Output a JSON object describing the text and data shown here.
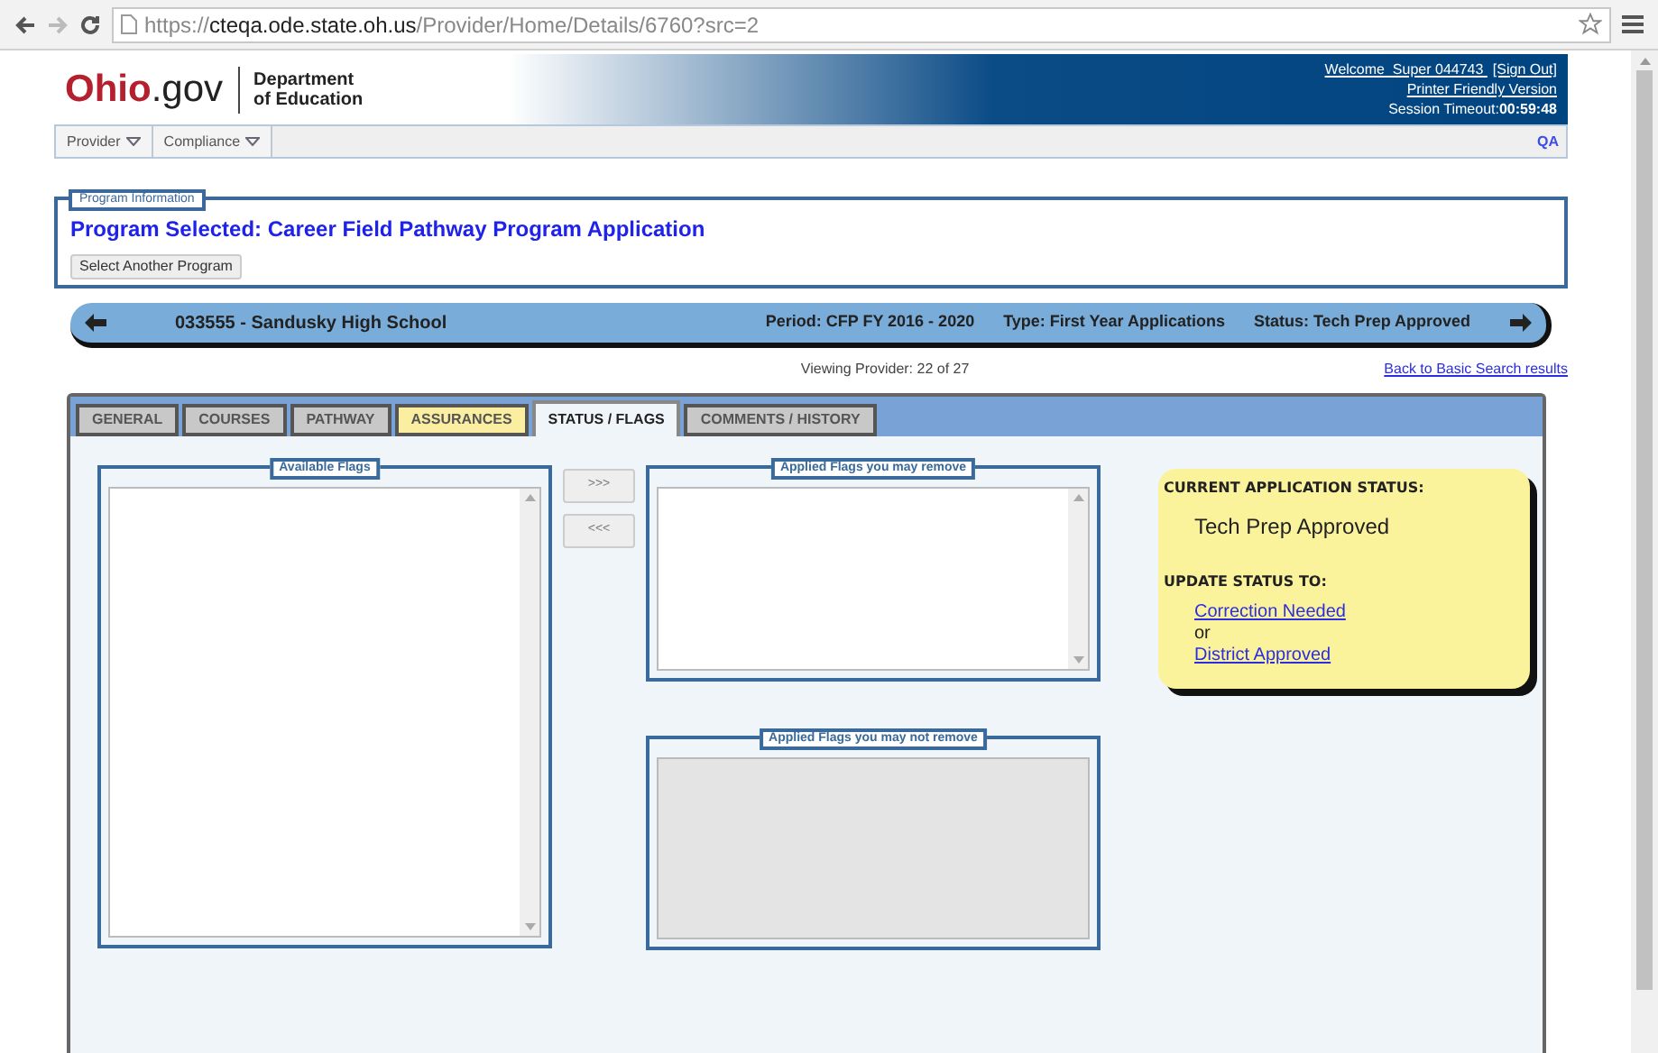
{
  "browser": {
    "url_scheme": "https://",
    "url_host": "cteqa.ode.state.oh.us",
    "url_path": "/Provider/Home/Details/6760?src=2"
  },
  "header": {
    "logo_ohio": "Ohio",
    "logo_gov": ".gov",
    "department": "Department",
    "department_2": "of Education",
    "welcome": "Welcome  Super 044743 ",
    "sign_out": "[Sign Out]",
    "printer": "Printer Friendly Version",
    "timeout_label": "Session Timeout:",
    "timeout_value": "00:59:48"
  },
  "menu": [
    {
      "label": "Provider"
    },
    {
      "label": "Compliance"
    }
  ],
  "menu_right": "QA",
  "program_info": {
    "legend": "Program Information",
    "title": "Program Selected: Career Field Pathway Program Application",
    "button": "Select Another Program"
  },
  "provider_bar": {
    "name": "033555 - Sandusky High School",
    "period": "Period: CFP FY 2016 - 2020",
    "type": "Type: First Year Applications",
    "status": "Status: Tech Prep Approved"
  },
  "viewing": "Viewing Provider: 22 of 27",
  "back_link": "Back to Basic Search results",
  "tabs": [
    {
      "label": "GENERAL",
      "selected": false,
      "highlighted": false
    },
    {
      "label": "COURSES",
      "selected": false,
      "highlighted": false
    },
    {
      "label": "PATHWAY",
      "selected": false,
      "highlighted": false
    },
    {
      "label": "ASSURANCES",
      "selected": false,
      "highlighted": true
    },
    {
      "label": "STATUS / FLAGS",
      "selected": true,
      "highlighted": false
    },
    {
      "label": "COMMENTS / HISTORY",
      "selected": false,
      "highlighted": false
    }
  ],
  "flags": {
    "available": "Available Flags",
    "removable": "Applied Flags you may remove",
    "not_removable": "Applied Flags you may not remove",
    "add_button": ">>>",
    "remove_button": "<<<"
  },
  "status_card": {
    "current_label": "CURRENT APPLICATION STATUS:",
    "current_value": "Tech Prep Approved",
    "update_label": "UPDATE STATUS TO:",
    "options": [
      "Correction Needed",
      "District Approved"
    ],
    "separator": "or"
  }
}
